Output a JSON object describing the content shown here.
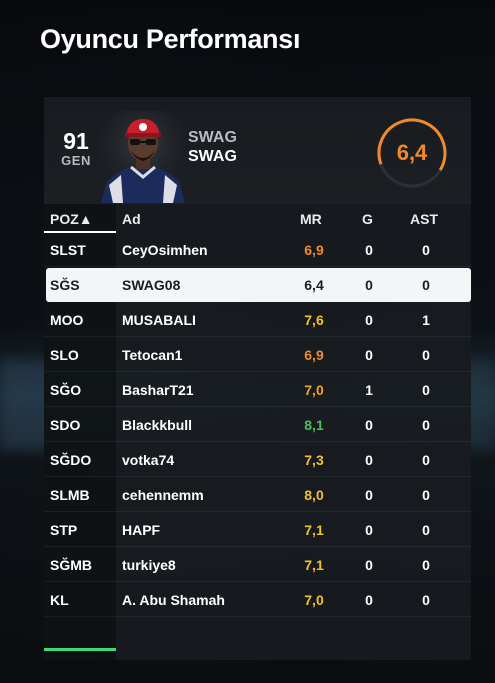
{
  "title": "Oyuncu Performansı",
  "player": {
    "gen_value": "91",
    "gen_label": "GEN",
    "first_name": "SWAG",
    "last_name": "SWAG",
    "rating": "6,4",
    "avatar_icon": "player-avatar-icon"
  },
  "columns": {
    "poz": "POZ▲",
    "ad": "Ad",
    "mr": "MR",
    "g": "G",
    "ast": "AST"
  },
  "colors": {
    "rating_orange": "#f08a2c",
    "rating_yellow": "#f2c12e",
    "rating_green": "#4fbf5f",
    "accent_green": "#3fd77a"
  },
  "rows": [
    {
      "pos": "SLST",
      "name": "CeyOsimhen",
      "mr": "6,9",
      "g": "0",
      "ast": "0",
      "mr_color": "#f08a2c"
    },
    {
      "pos": "SĞS",
      "name": "SWAG08",
      "mr": "6,4",
      "g": "0",
      "ast": "0",
      "mr_color": "#1a1c20",
      "selected": true
    },
    {
      "pos": "MOO",
      "name": "MUSABALI",
      "mr": "7,6",
      "g": "0",
      "ast": "1",
      "mr_color": "#f2c12e"
    },
    {
      "pos": "SLO",
      "name": "Tetocan1",
      "mr": "6,9",
      "g": "0",
      "ast": "0",
      "mr_color": "#f08a2c"
    },
    {
      "pos": "SĞO",
      "name": "BasharT21",
      "mr": "7,0",
      "g": "1",
      "ast": "0",
      "mr_color": "#f2a22a"
    },
    {
      "pos": "SDO",
      "name": "Blackkbull",
      "mr": "8,1",
      "g": "0",
      "ast": "0",
      "mr_color": "#4fbf5f"
    },
    {
      "pos": "SĞDO",
      "name": "votka74",
      "mr": "7,3",
      "g": "0",
      "ast": "0",
      "mr_color": "#f2c12e"
    },
    {
      "pos": "SLMB",
      "name": "cehennemm",
      "mr": "8,0",
      "g": "0",
      "ast": "0",
      "mr_color": "#f2c12e"
    },
    {
      "pos": "STP",
      "name": "HAPF",
      "mr": "7,1",
      "g": "0",
      "ast": "0",
      "mr_color": "#f2c12e"
    },
    {
      "pos": "SĞMB",
      "name": "turkiye8",
      "mr": "7,1",
      "g": "0",
      "ast": "0",
      "mr_color": "#f2c12e"
    },
    {
      "pos": "KL",
      "name": "A. Abu Shamah",
      "mr": "7,0",
      "g": "0",
      "ast": "0",
      "mr_color": "#f2c12e"
    }
  ]
}
